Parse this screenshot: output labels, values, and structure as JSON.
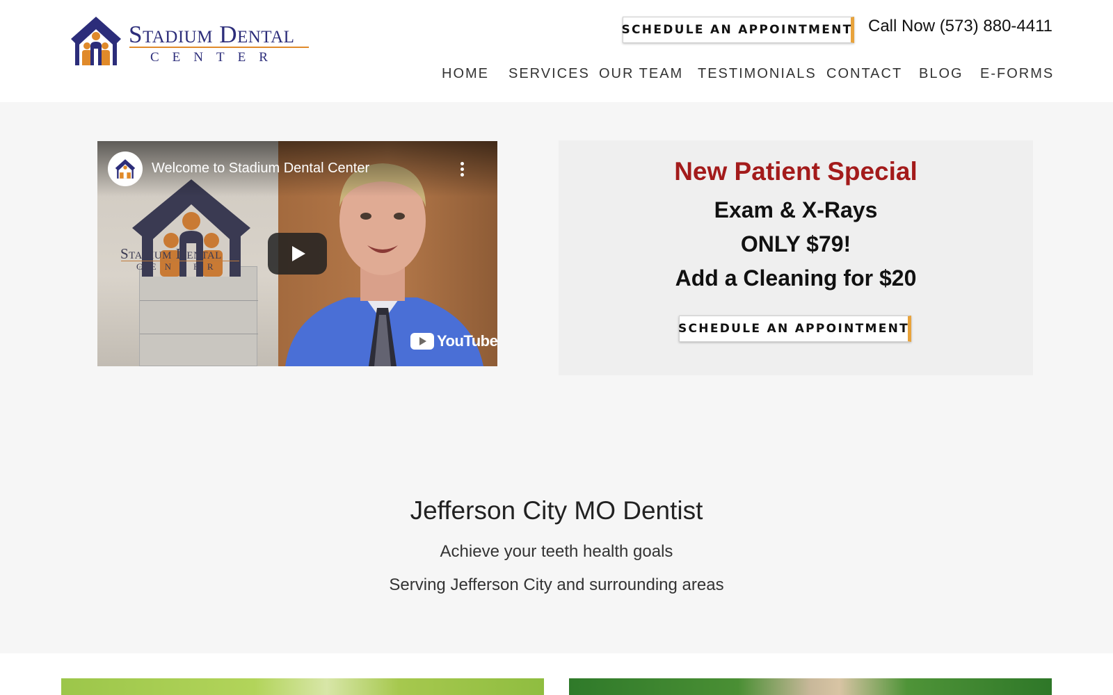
{
  "brand": {
    "name_line1": "Stadium Dental",
    "name_line2": "CENTER",
    "colors": {
      "navy": "#2c2d7a",
      "orange": "#e08a2a",
      "accent": "#e8a33c",
      "red": "#a31b1b"
    }
  },
  "header": {
    "schedule_label": "SCHEDULE AN APPOINTMENT",
    "call_now": "Call Now (573) 880-4411"
  },
  "nav": {
    "items": [
      {
        "label": "HOME"
      },
      {
        "label": "SERVICES"
      },
      {
        "label": "OUR TEAM"
      },
      {
        "label": "TESTIMONIALS"
      },
      {
        "label": "CONTACT"
      },
      {
        "label": "BLOG"
      },
      {
        "label": "E-FORMS"
      }
    ]
  },
  "video": {
    "title": "Welcome to Stadium Dental Center",
    "platform": "YouTube",
    "logo_line1": "Stadium Dental",
    "logo_line2": "CENTER",
    "icons": [
      "channel-avatar-icon",
      "more-vert-icon",
      "play-icon",
      "youtube-icon"
    ]
  },
  "special": {
    "title": "New Patient Special",
    "line1": "Exam & X-Rays",
    "line2": "ONLY $79!",
    "line3": "Add a Cleaning for $20",
    "button_label": "SCHEDULE AN APPOINTMENT"
  },
  "intro": {
    "title": "Jefferson City MO Dentist",
    "sub1": "Achieve your teeth health goals",
    "sub2": "Serving Jefferson City and surrounding areas"
  }
}
